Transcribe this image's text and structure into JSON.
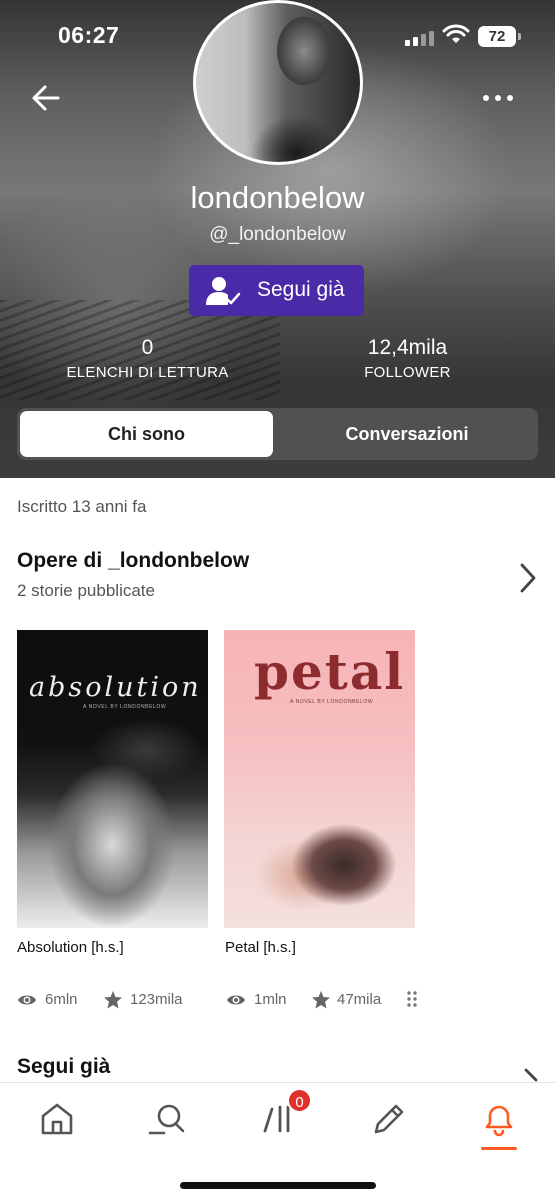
{
  "status_bar": {
    "time": "06:27",
    "battery": "72",
    "icons": [
      "cellular-signal-icon",
      "wifi-icon",
      "battery-icon"
    ]
  },
  "header": {
    "back_icon": "arrow-left-icon",
    "more_icon": "more-dots-icon",
    "username": "londonbelow",
    "handle": "@_londonbelow",
    "follow_button": {
      "label": "Segui già",
      "icon": "person-check-icon",
      "color": "#4b2aa8"
    },
    "stats": {
      "reading_lists": {
        "value": "0",
        "label": "ELENCHI DI LETTURA"
      },
      "followers": {
        "value": "12,4mila",
        "label": "FOLLOWER"
      }
    },
    "tabs": [
      {
        "label": "Chi sono",
        "active": true
      },
      {
        "label": "Conversazioni",
        "active": false
      }
    ]
  },
  "content": {
    "joined": "Iscritto 13 anni fa",
    "works": {
      "title": "Opere di _londonbelow",
      "subtitle": "2 storie pubblicate",
      "stories": [
        {
          "title": "Absolution [h.s.]",
          "cover_title": "absolution",
          "cover_tagline": "A NOVEL BY LONDONBELOW",
          "reads": "6mln",
          "votes": "123mila"
        },
        {
          "title": "Petal [h.s.]",
          "cover_title": "petal",
          "cover_tagline": "A NOVEL BY LONDONBELOW",
          "reads": "1mln",
          "votes": "47mila"
        }
      ]
    },
    "following": {
      "title": "Segui già"
    }
  },
  "bottom_nav": {
    "items": [
      "home-icon",
      "search-icon",
      "library-icon",
      "write-icon",
      "notifications-icon"
    ],
    "library_badge": "0",
    "active": "notifications-icon",
    "accent_color": "#ff5a1f"
  }
}
